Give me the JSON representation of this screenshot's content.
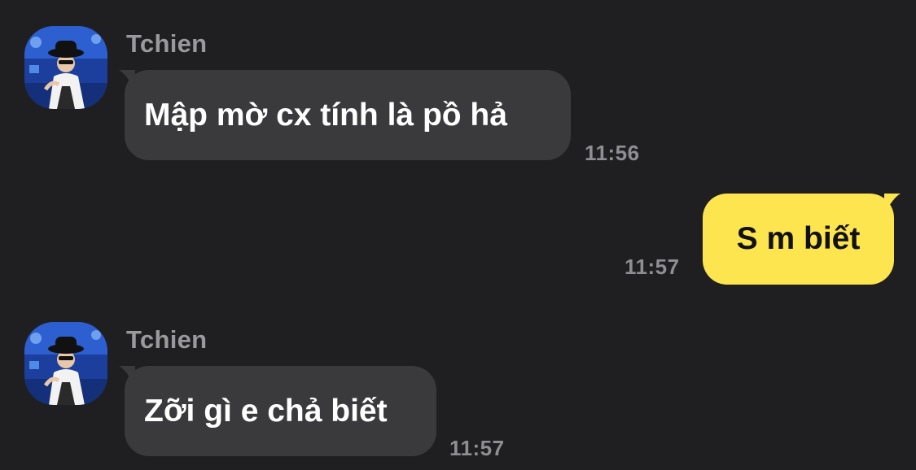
{
  "messages": [
    {
      "sender": "Tchien",
      "text": "Mập mờ cx tính là pồ hả",
      "time": "11:56",
      "direction": "incoming"
    },
    {
      "text": "S m biết",
      "time": "11:57",
      "direction": "outgoing"
    },
    {
      "sender": "Tchien",
      "text": "Zỡi gì e chả biết",
      "time": "11:57",
      "direction": "incoming"
    }
  ],
  "colors": {
    "background": "#1f1f21",
    "incoming_bubble": "#3a3a3c",
    "outgoing_bubble": "#fde54f",
    "sender_name": "#9a9a9e",
    "timestamp": "#8e8e93"
  }
}
